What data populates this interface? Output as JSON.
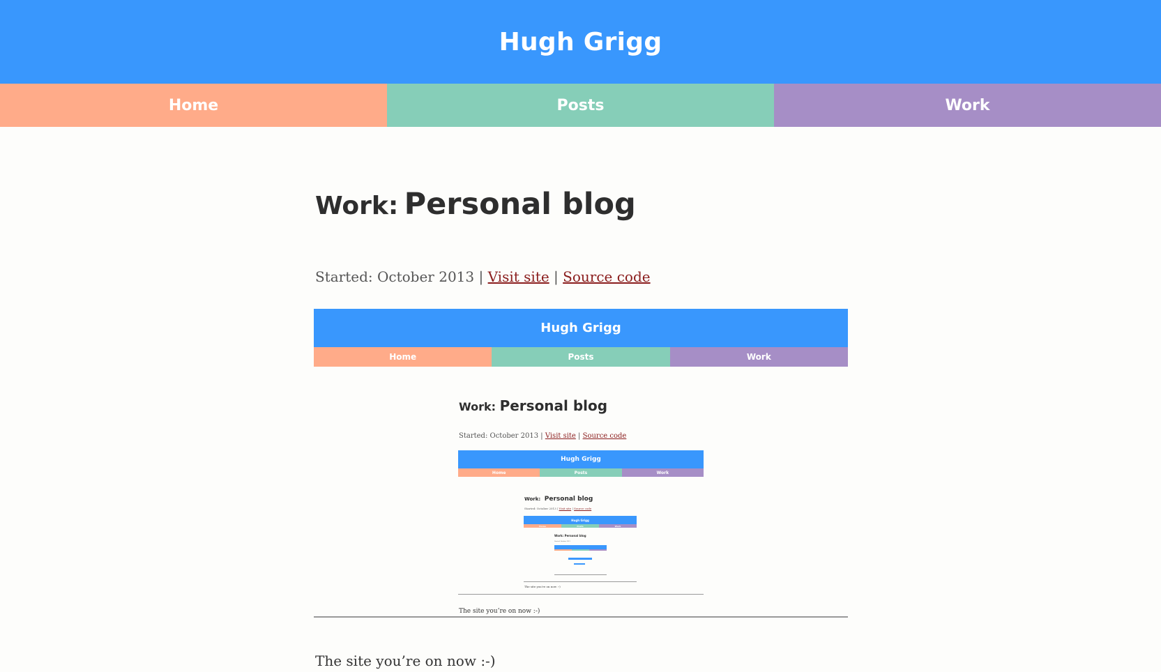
{
  "header": {
    "title": "Hugh Grigg"
  },
  "nav": {
    "items": [
      {
        "label": "Home",
        "color": "#ffab89"
      },
      {
        "label": "Posts",
        "color": "#86ceb8"
      },
      {
        "label": "Work",
        "color": "#a68ec6"
      }
    ]
  },
  "main": {
    "title_prefix": "Work:",
    "title": "Personal blog",
    "meta": {
      "started": "Started: October 2013",
      "separator": "|",
      "visit_label": "Visit site",
      "source_label": "Source code"
    },
    "caption": "The site you’re on now :-)"
  },
  "colors": {
    "header": "#3997fd",
    "link": "#8a1c1c",
    "text": "#333333"
  }
}
